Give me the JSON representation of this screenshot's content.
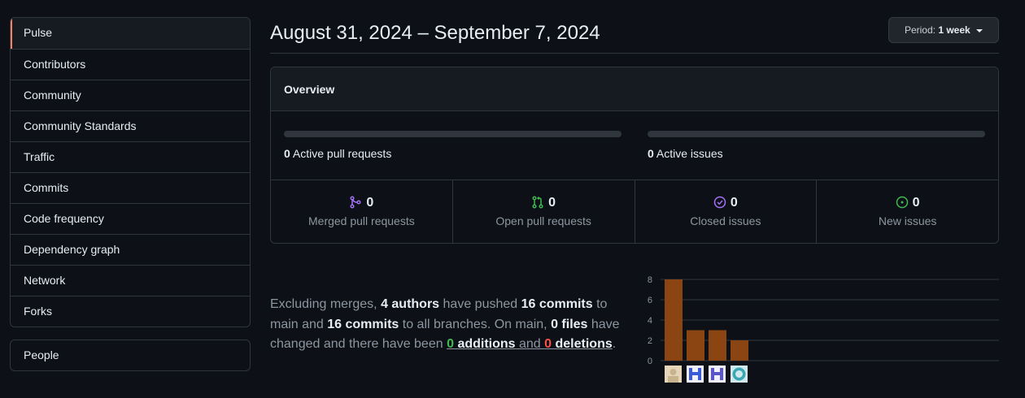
{
  "sidebar": {
    "items": [
      {
        "label": "Pulse"
      },
      {
        "label": "Contributors"
      },
      {
        "label": "Community"
      },
      {
        "label": "Community Standards"
      },
      {
        "label": "Traffic"
      },
      {
        "label": "Commits"
      },
      {
        "label": "Code frequency"
      },
      {
        "label": "Dependency graph"
      },
      {
        "label": "Network"
      },
      {
        "label": "Forks"
      }
    ],
    "people_label": "People"
  },
  "header": {
    "date_range": "August 31, 2024 – September 7, 2024",
    "period_prefix": "Period:",
    "period_value": "1 week"
  },
  "overview": {
    "title": "Overview",
    "active_prs_count": "0",
    "active_prs_label": "Active pull requests",
    "active_issues_count": "0",
    "active_issues_label": "Active issues",
    "stats": [
      {
        "count": "0",
        "label": "Merged pull requests",
        "icon": "git-merge-icon",
        "color": "#a371f7"
      },
      {
        "count": "0",
        "label": "Open pull requests",
        "icon": "git-pull-request-icon",
        "color": "#3fb950"
      },
      {
        "count": "0",
        "label": "Closed issues",
        "icon": "issue-closed-icon",
        "color": "#a371f7"
      },
      {
        "count": "0",
        "label": "New issues",
        "icon": "issue-opened-icon",
        "color": "#3fb950"
      }
    ]
  },
  "summary": {
    "t1": "Excluding merges, ",
    "authors": "4 authors",
    "t2": " have pushed ",
    "commits_main": "16 commits",
    "t3": " to main and ",
    "commits_all": "16 commits",
    "t4": " to all branches. On main, ",
    "files": "0 files",
    "t5": " have changed and there have been ",
    "additions_count": "0",
    "additions_word": "additions",
    "t6": " and ",
    "deletions_count": "0",
    "deletions_word": "deletions",
    "t7": "."
  },
  "chart_data": {
    "type": "bar",
    "categories": [
      "author-1",
      "author-2",
      "author-3",
      "author-4"
    ],
    "values": [
      8,
      3,
      3,
      2
    ],
    "yticks": [
      "0",
      "2",
      "4",
      "6",
      "8"
    ],
    "ylim": [
      0,
      8
    ],
    "bar_color": "#8b4513",
    "grid": true
  }
}
